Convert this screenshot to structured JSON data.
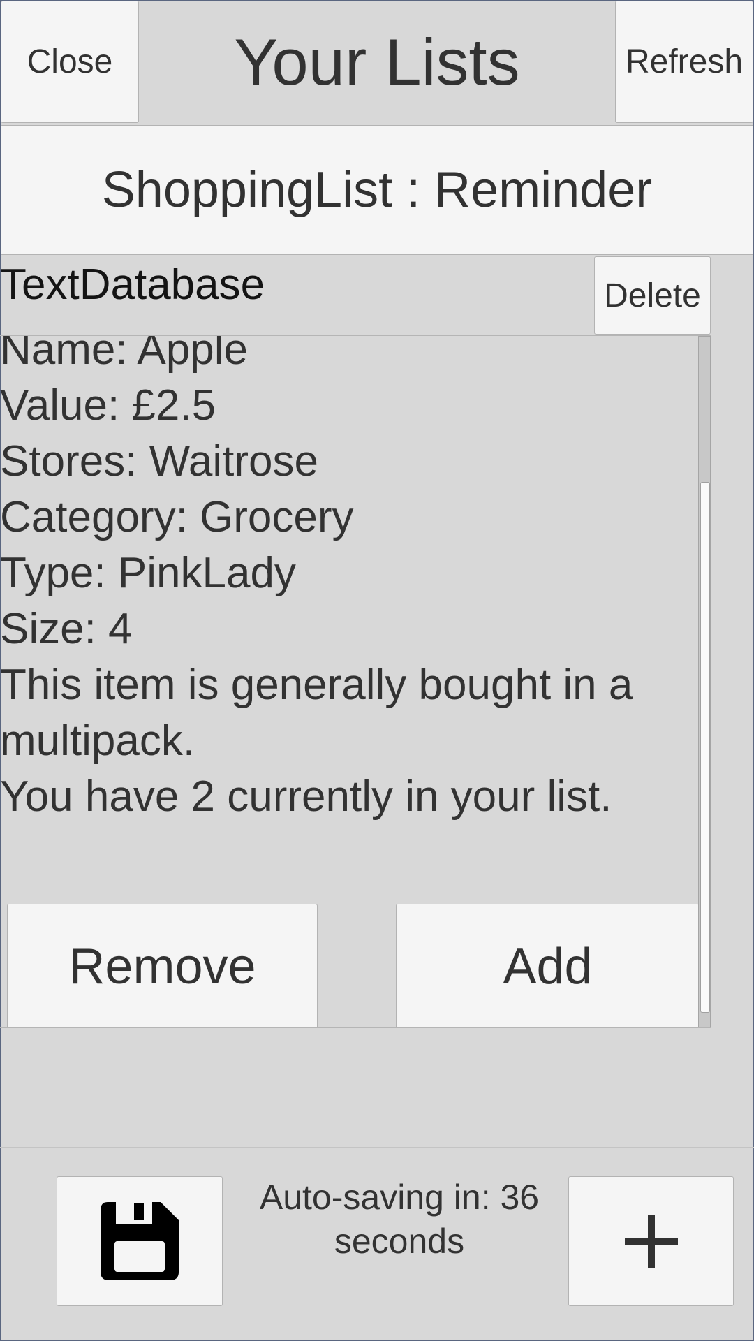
{
  "header": {
    "close_label": "Close",
    "title": "Your Lists",
    "refresh_label": "Refresh"
  },
  "list_button": {
    "label": "ShoppingList : Reminder"
  },
  "item_panel": {
    "source_label": "TextDatabase",
    "delete_label": "Delete",
    "details": [
      "Name: Apple",
      "Value: £2.5",
      "Stores: Waitrose",
      "Category: Grocery",
      "Type: PinkLady",
      "Size: 4",
      "This item is generally bought in a multipack.",
      "You have 2 currently in your list."
    ],
    "remove_label": "Remove",
    "add_label": "Add"
  },
  "footer": {
    "save_icon": "floppy-disk-icon",
    "autosave_text": "Auto-saving in: 36 seconds",
    "new_icon": "plus-icon"
  },
  "colors": {
    "background": "#d8d8d8",
    "button": "#f5f5f5",
    "text": "#323232"
  }
}
